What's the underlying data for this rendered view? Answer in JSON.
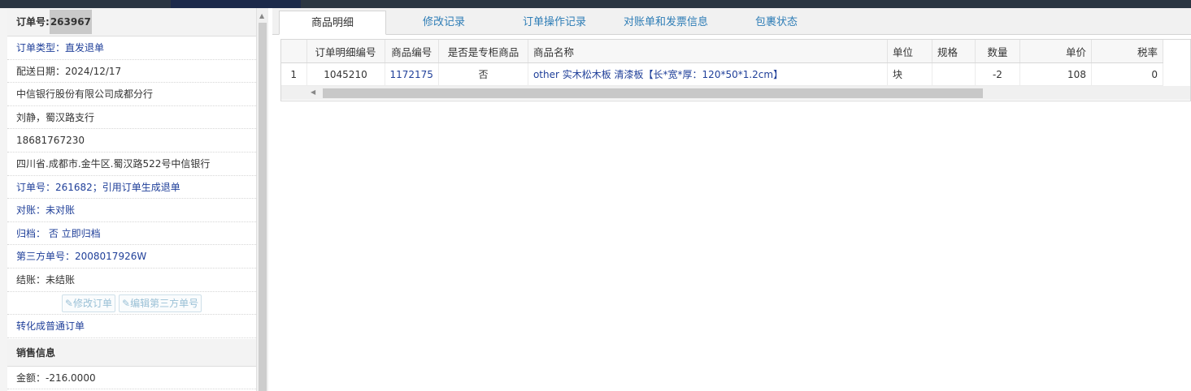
{
  "order": {
    "label": "订单号:",
    "number": "263967",
    "type": "订单类型：直发退单",
    "delivery_date": "配送日期：2024/12/17",
    "company": "中信银行股份有限公司成都分行",
    "contact": "刘静，蜀汉路支行",
    "phone": "18681767230",
    "address": "四川省.成都市.金牛区.蜀汉路522号中信银行",
    "ref_order": "订单号：261682；引用订单生成退单",
    "reconcile": "对账：未对账",
    "archive": "归档： 否 立即归档",
    "third_party": "第三方单号：2008017926W",
    "settle": "结账：未结账",
    "btn_edit_order": "修改订单",
    "btn_edit_third": "编辑第三方单号",
    "convert": "转化成普通订单",
    "sales_header": "销售信息",
    "amount": "金额：-216.0000"
  },
  "tabs": [
    "商品明细",
    "修改记录",
    "订单操作记录",
    "对账单和发票信息",
    "包裹状态"
  ],
  "grid": {
    "columns": [
      "",
      "订单明细编号",
      "商品编号",
      "是否是专柜商品",
      "商品名称",
      "单位",
      "规格",
      "数量",
      "单价",
      "税率"
    ],
    "rows": [
      {
        "idx": "1",
        "detail_no": "1045210",
        "product_no": "1172175",
        "counter": "否",
        "name": "other 实木松木板 清漆板【长*宽*厚：120*50*1.2cm】",
        "unit": "块",
        "spec": "",
        "qty": "-2",
        "price": "108",
        "tax": "0"
      }
    ]
  },
  "icons": {
    "edit": "edit-icon",
    "scroll_up": "arrow-up-icon",
    "scroll_left": "arrow-left-icon"
  },
  "colors": {
    "link": "#1f3f99",
    "tab_link": "#2e7db6"
  }
}
